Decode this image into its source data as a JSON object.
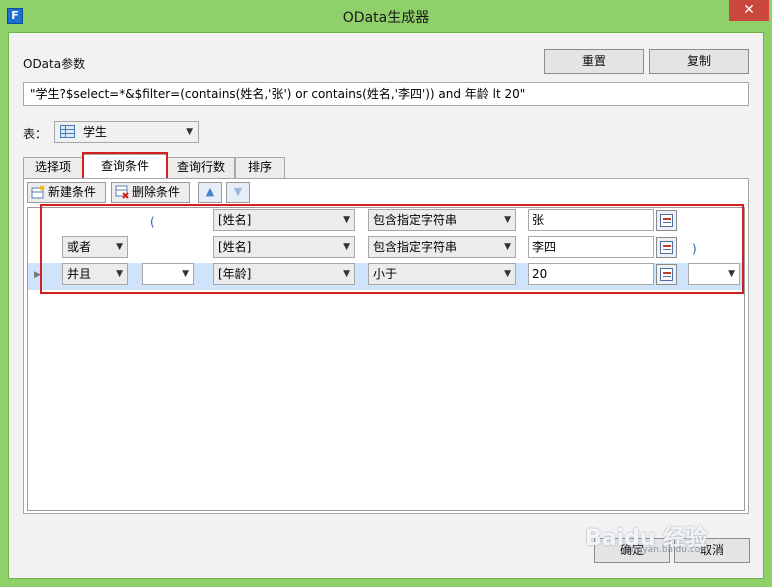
{
  "window": {
    "title": "OData生成器",
    "icon_letter": "F",
    "close_glyph": "✕"
  },
  "odata": {
    "label": "OData参数",
    "reset_label": "重置",
    "copy_label": "复制",
    "query": "\"学生?$select=*&$filter=(contains(姓名,'张') or contains(姓名,'李四')) and 年龄 lt 20\""
  },
  "table": {
    "label": "表：",
    "selected": "学生"
  },
  "tabs": [
    {
      "label": "选择项"
    },
    {
      "label": "查询条件"
    },
    {
      "label": "查询行数"
    },
    {
      "label": "排序"
    }
  ],
  "toolbar": {
    "new_label": "新建条件",
    "delete_label": "删除条件",
    "up_glyph": "▲",
    "down_glyph": "▼"
  },
  "conditions": [
    {
      "logic": "",
      "open_paren": "(",
      "field": "[姓名]",
      "operator": "包含指定字符串",
      "value": "张",
      "close_paren": ""
    },
    {
      "logic": "或者",
      "open_paren": "",
      "field": "[姓名]",
      "operator": "包含指定字符串",
      "value": "李四",
      "close_paren": ")"
    },
    {
      "logic": "并且",
      "open_paren": "",
      "field": "[年龄]",
      "operator": "小于",
      "value": "20",
      "close_paren": ""
    }
  ],
  "footer": {
    "ok_label": "确定",
    "cancel_label": "取消"
  },
  "watermark": {
    "text": "Baidu 经验",
    "sub": "jingyan.baidu.com"
  },
  "colors": {
    "frame": "#8fd06a",
    "close": "#c9473d",
    "highlight": "#d42020",
    "selected_row": "#cfe3fb"
  }
}
